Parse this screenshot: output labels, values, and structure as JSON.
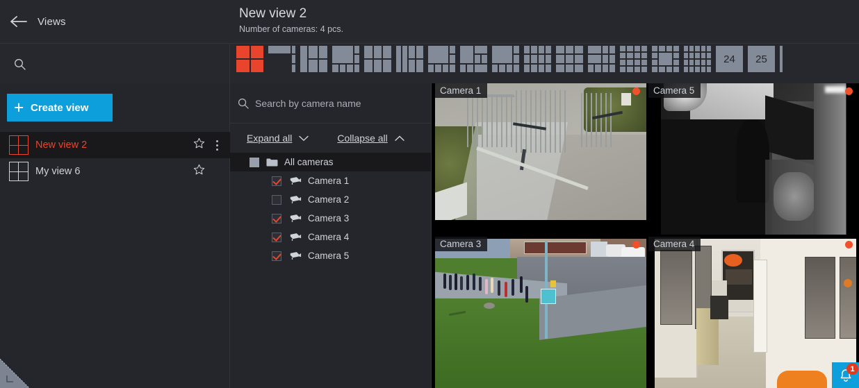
{
  "topbar": {
    "back_icon": "arrow-left-icon",
    "views_label": "Views",
    "title": "New view 2",
    "subtitle": "Number of cameras: 4 pcs.",
    "search_icon": "search-icon"
  },
  "layout_picker": {
    "selected_index": 0,
    "buttons": [
      {
        "name": "layout-2x2",
        "cols": 2,
        "rows": 2,
        "selected": true
      },
      {
        "name": "layout-1-plus-3-right",
        "pattern": "big-left-3-right"
      },
      {
        "name": "layout-1-plus-4",
        "pattern": "tall-left-4"
      },
      {
        "name": "layout-big-top-3-bottom",
        "pattern": "big-3-bottom"
      },
      {
        "name": "layout-3x2",
        "cols": 3,
        "rows": 2
      },
      {
        "name": "layout-2-tall-4",
        "pattern": "two-tall-4"
      },
      {
        "name": "layout-big-left-5",
        "pattern": "big-left-5"
      },
      {
        "name": "layout-big-5-mixed",
        "pattern": "big-5-mixed"
      },
      {
        "name": "layout-big-plus-4-bottom",
        "pattern": "big-4-bottom"
      },
      {
        "name": "layout-4x3-tall",
        "cols": 4,
        "rows": 3
      },
      {
        "name": "layout-3x3-plus",
        "cols": 3,
        "rows": 3
      },
      {
        "name": "layout-2x2-plus-4",
        "pattern": "quad-4"
      },
      {
        "name": "layout-4x4",
        "cols": 4,
        "rows": 4
      },
      {
        "name": "layout-big-center-12",
        "pattern": "center-big"
      },
      {
        "name": "layout-5x4",
        "cols": 5,
        "rows": 4
      }
    ],
    "number_buttons": [
      "24",
      "25"
    ],
    "scrollbar": {
      "name": "layout-scrollbar"
    }
  },
  "sidebar": {
    "create_view_label": "Create view",
    "plus_icon": "plus-icon",
    "views": [
      {
        "name": "New view 2",
        "active": true,
        "icon": "grid-2x2-icon",
        "star": "star-outline-icon",
        "menu": "more-vertical-icon"
      },
      {
        "name": "My view 6",
        "active": false,
        "icon": "grid-2x2-icon",
        "star": "star-outline-icon"
      }
    ]
  },
  "camera_tree": {
    "search_placeholder": "Search by camera name",
    "search_icon": "search-icon",
    "expand_all_label": "Expand all",
    "collapse_all_label": "Collapse all",
    "expand_icon": "chevron-down-icon",
    "collapse_icon": "chevron-up-icon",
    "root": {
      "label": "All cameras",
      "state": "indeterminate",
      "icon": "folder-icon"
    },
    "cameras": [
      {
        "label": "Camera 1",
        "checked": true,
        "icon": "camera-icon"
      },
      {
        "label": "Camera 2",
        "checked": false,
        "icon": "camera-icon"
      },
      {
        "label": "Camera 3",
        "checked": true,
        "icon": "camera-icon"
      },
      {
        "label": "Camera 4",
        "checked": true,
        "icon": "camera-icon"
      },
      {
        "label": "Camera 5",
        "checked": true,
        "icon": "camera-icon"
      }
    ]
  },
  "video_grid": {
    "tiles": [
      {
        "label": "Camera 1",
        "recording": true,
        "scene": "outdoor-gate-driveway"
      },
      {
        "label": "Camera 5",
        "recording": true,
        "scene": "infrared-vehicle-closeup"
      },
      {
        "label": "Camera 3",
        "recording": true,
        "scene": "campus-walkway-people"
      },
      {
        "label": "Camera 4",
        "recording": true,
        "scene": "indoor-office-corridor"
      }
    ]
  },
  "overlays": {
    "notification": {
      "icon": "bell-icon",
      "count": "1"
    },
    "resize_handle": {
      "icon": "resize-corner-icon"
    }
  },
  "colors": {
    "accent_blue": "#0c9fdb",
    "accent_red": "#e8452c",
    "rec_dot": "#f0502c",
    "panel_bg": "#24262b",
    "topbar_bg": "#26282d",
    "active_row": "#19191c",
    "icon_gray": "#838b99",
    "text": "#cfd3da"
  }
}
